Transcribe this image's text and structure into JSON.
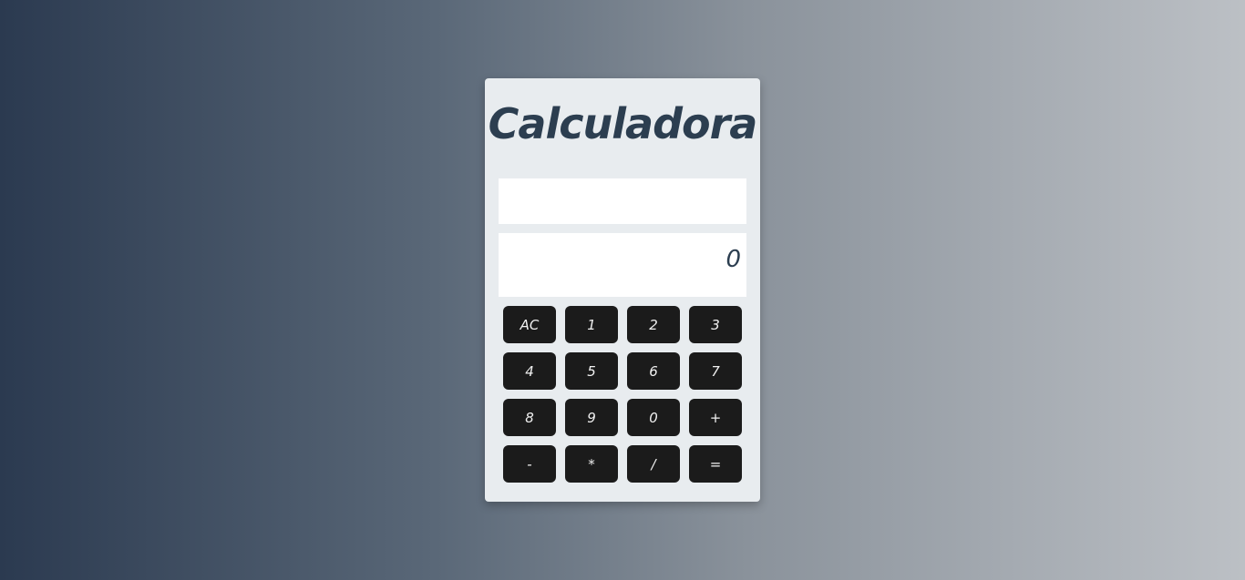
{
  "app": {
    "title": "Calculadora"
  },
  "display": {
    "previous_value": "",
    "current_value": "0"
  },
  "keypad": {
    "keys": [
      "AC",
      "1",
      "2",
      "3",
      "4",
      "5",
      "6",
      "7",
      "8",
      "9",
      "0",
      "+",
      "-",
      "*",
      "/",
      "="
    ]
  },
  "colors": {
    "title_color": "#2c3e50",
    "panel_bg": "#e8ecef",
    "key_bg": "#1b1b1b",
    "key_text": "#f0f0f0"
  }
}
